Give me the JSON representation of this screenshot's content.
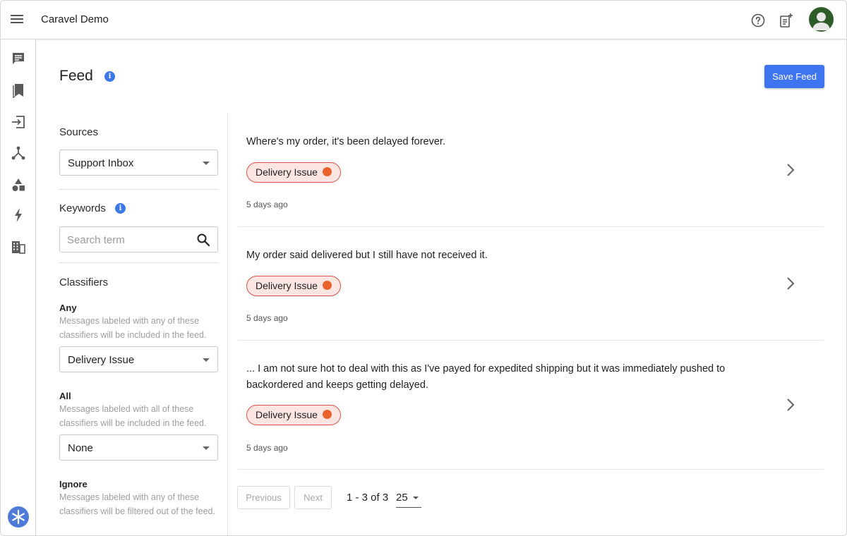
{
  "app": {
    "title": "Caravel Demo"
  },
  "page": {
    "title": "Feed",
    "save_label": "Save Feed"
  },
  "filters": {
    "sources": {
      "label": "Sources",
      "value": "Support Inbox"
    },
    "keywords": {
      "label": "Keywords",
      "placeholder": "Search term"
    },
    "classifiers": {
      "label": "Classifiers",
      "any": {
        "label": "Any",
        "help": "Messages labeled with any of these classifiers will be included in the feed.",
        "value": "Delivery Issue"
      },
      "all": {
        "label": "All",
        "help": "Messages labeled with all of these classifiers will be included in the feed.",
        "value": "None"
      },
      "ignore": {
        "label": "Ignore",
        "help": "Messages labeled with any of these classifiers will be filtered out of the feed."
      }
    }
  },
  "feed": {
    "items": [
      {
        "text": "Where's my order, it's been delayed forever.",
        "tag": "Delivery Issue",
        "time": "5 days ago"
      },
      {
        "text": "My order said delivered but I still have not received it.",
        "tag": "Delivery Issue",
        "time": "5 days ago"
      },
      {
        "text": "... I am not sure hot to deal with this as I've payed for expedited shipping but it was immediately pushed to backordered and keeps getting delayed.",
        "tag": "Delivery Issue",
        "time": "5 days ago"
      }
    ]
  },
  "pagination": {
    "previous": "Previous",
    "next": "Next",
    "count": "1 - 3 of 3",
    "page_size": "25"
  },
  "colors": {
    "primary": "#3f74f0",
    "info": "#3c78e8",
    "tag_border": "#d9534f",
    "tag_bg": "#fbe5e3",
    "avatar": "#2f5d2a"
  },
  "icons": {
    "nav": [
      "messages-icon",
      "bookmark-icon",
      "sign-in-icon",
      "hierarchy-icon",
      "shapes-icon",
      "lightning-icon",
      "building-icon"
    ],
    "top": [
      "help-icon",
      "note-add-icon"
    ]
  }
}
